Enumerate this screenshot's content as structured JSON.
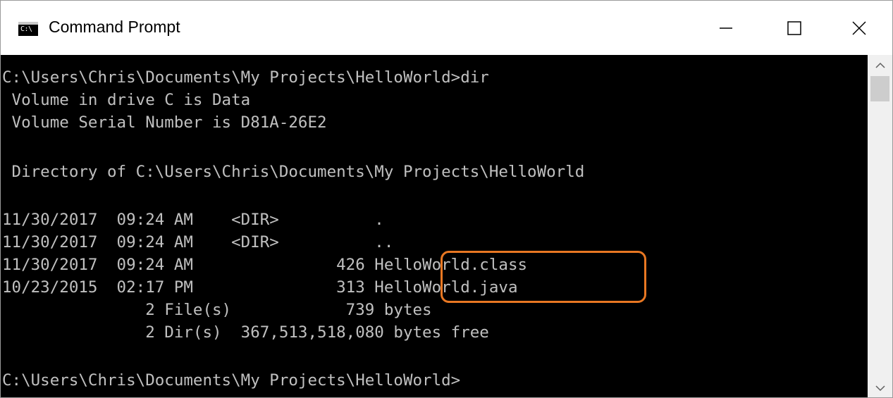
{
  "window": {
    "title": "Command Prompt",
    "icon_name": "cmd-icon",
    "icon_text": "C:\\",
    "controls": {
      "minimize": "minimize-icon",
      "maximize": "maximize-icon",
      "close": "close-icon"
    }
  },
  "terminal": {
    "text_color": "#c0c0c0",
    "background": "#000000",
    "lines": [
      "C:\\Users\\Chris\\Documents\\My Projects\\HelloWorld>dir",
      " Volume in drive C is Data",
      " Volume Serial Number is D81A-26E2",
      "",
      " Directory of C:\\Users\\Chris\\Documents\\My Projects\\HelloWorld",
      "",
      "11/30/2017  09:24 AM    <DIR>          .",
      "11/30/2017  09:24 AM    <DIR>          ..",
      "11/30/2017  09:24 AM               426 HelloWorld.class",
      "10/23/2015  02:17 PM               313 HelloWorld.java",
      "               2 File(s)            739 bytes",
      "               2 Dir(s)  367,513,518,080 bytes free",
      "",
      "C:\\Users\\Chris\\Documents\\My Projects\\HelloWorld>"
    ]
  },
  "annotation": {
    "highlight_color": "#e87722"
  }
}
